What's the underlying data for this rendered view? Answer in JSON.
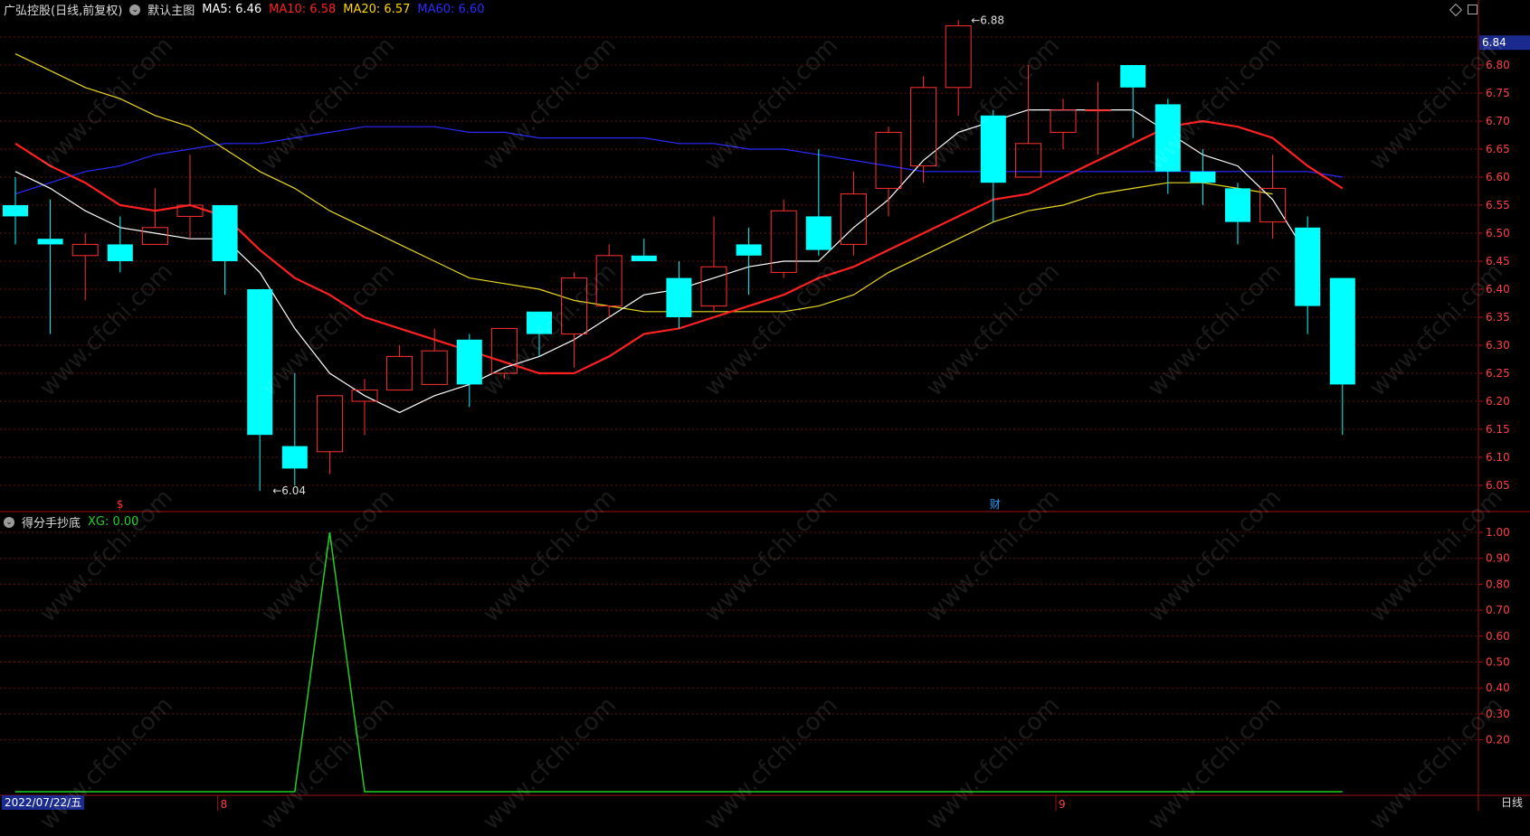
{
  "header": {
    "stock": "广弘控股(日线,前复权)",
    "main_label": "默认主图",
    "ma": [
      {
        "label": "MA5: 6.46",
        "color": "#ffffff"
      },
      {
        "label": "MA10: 6.58",
        "color": "#ff2020"
      },
      {
        "label": "MA20: 6.57",
        "color": "#ffd700"
      },
      {
        "label": "MA60: 6.60",
        "color": "#2a2aff"
      }
    ]
  },
  "indicator": {
    "name": "得分手抄底",
    "value_label": "XG: 0.00"
  },
  "footer": {
    "date": "2022/07/22/五",
    "period": "日线"
  },
  "watermark": "www.cfchi.com",
  "colors": {
    "up": "#ff3030",
    "down": "#00ffff",
    "grid": "#6a1010",
    "frame": "#a01010",
    "ma5": "#ffffff",
    "ma10": "#ff2020",
    "ma20": "#e8d820",
    "ma60": "#2a2aff",
    "xg": "#20d020"
  },
  "chart_data": [
    {
      "type": "candlestick",
      "ylim": [
        6.0,
        6.9
      ],
      "y_ticks": [
        "6.80",
        "6.75",
        "6.70",
        "6.65",
        "6.60",
        "6.55",
        "6.50",
        "6.45",
        "6.40",
        "6.35",
        "6.30",
        "6.25",
        "6.20",
        "6.15",
        "6.10",
        "6.05"
      ],
      "current_price": "6.84",
      "annotations": [
        {
          "text": "6.88",
          "index": 27,
          "value": 6.88
        },
        {
          "text": "6.04",
          "index": 7,
          "value": 6.04
        }
      ],
      "markers": [
        {
          "text": "$",
          "index": 3,
          "color": "#ff3030"
        },
        {
          "text": "财",
          "index": 28,
          "color": "#20a0ff"
        }
      ],
      "month_ticks": [
        {
          "text": "8",
          "index": 6
        },
        {
          "text": "9",
          "index": 30
        }
      ],
      "candles": [
        {
          "o": 6.55,
          "h": 6.6,
          "l": 6.48,
          "c": 6.53
        },
        {
          "o": 6.49,
          "h": 6.56,
          "l": 6.32,
          "c": 6.48
        },
        {
          "o": 6.46,
          "h": 6.5,
          "l": 6.38,
          "c": 6.48
        },
        {
          "o": 6.48,
          "h": 6.53,
          "l": 6.43,
          "c": 6.45
        },
        {
          "o": 6.48,
          "h": 6.58,
          "l": 6.48,
          "c": 6.51
        },
        {
          "o": 6.53,
          "h": 6.64,
          "l": 6.49,
          "c": 6.55
        },
        {
          "o": 6.55,
          "h": 6.55,
          "l": 6.39,
          "c": 6.45
        },
        {
          "o": 6.4,
          "h": 6.4,
          "l": 6.04,
          "c": 6.14
        },
        {
          "o": 6.12,
          "h": 6.25,
          "l": 6.05,
          "c": 6.08
        },
        {
          "o": 6.11,
          "h": 6.21,
          "l": 6.07,
          "c": 6.21
        },
        {
          "o": 6.2,
          "h": 6.24,
          "l": 6.14,
          "c": 6.22
        },
        {
          "o": 6.22,
          "h": 6.3,
          "l": 6.22,
          "c": 6.28
        },
        {
          "o": 6.23,
          "h": 6.33,
          "l": 6.23,
          "c": 6.29
        },
        {
          "o": 6.31,
          "h": 6.32,
          "l": 6.19,
          "c": 6.23
        },
        {
          "o": 6.25,
          "h": 6.33,
          "l": 6.24,
          "c": 6.33
        },
        {
          "o": 6.36,
          "h": 6.36,
          "l": 6.28,
          "c": 6.32
        },
        {
          "o": 6.32,
          "h": 6.43,
          "l": 6.26,
          "c": 6.42
        },
        {
          "o": 6.37,
          "h": 6.48,
          "l": 6.35,
          "c": 6.46
        },
        {
          "o": 6.46,
          "h": 6.49,
          "l": 6.45,
          "c": 6.45
        },
        {
          "o": 6.42,
          "h": 6.45,
          "l": 6.33,
          "c": 6.35
        },
        {
          "o": 6.37,
          "h": 6.53,
          "l": 6.36,
          "c": 6.44
        },
        {
          "o": 6.48,
          "h": 6.51,
          "l": 6.39,
          "c": 6.46
        },
        {
          "o": 6.43,
          "h": 6.56,
          "l": 6.42,
          "c": 6.54
        },
        {
          "o": 6.53,
          "h": 6.65,
          "l": 6.46,
          "c": 6.47
        },
        {
          "o": 6.48,
          "h": 6.61,
          "l": 6.46,
          "c": 6.57
        },
        {
          "o": 6.58,
          "h": 6.69,
          "l": 6.53,
          "c": 6.68
        },
        {
          "o": 6.62,
          "h": 6.78,
          "l": 6.59,
          "c": 6.76
        },
        {
          "o": 6.76,
          "h": 6.88,
          "l": 6.71,
          "c": 6.87
        },
        {
          "o": 6.71,
          "h": 6.72,
          "l": 6.52,
          "c": 6.59
        },
        {
          "o": 6.6,
          "h": 6.8,
          "l": 6.6,
          "c": 6.66
        },
        {
          "o": 6.68,
          "h": 6.74,
          "l": 6.65,
          "c": 6.72
        },
        {
          "o": 6.72,
          "h": 6.77,
          "l": 6.64,
          "c": 6.72
        },
        {
          "o": 6.8,
          "h": 6.8,
          "l": 6.67,
          "c": 6.76
        },
        {
          "o": 6.73,
          "h": 6.74,
          "l": 6.57,
          "c": 6.61
        },
        {
          "o": 6.61,
          "h": 6.65,
          "l": 6.55,
          "c": 6.59
        },
        {
          "o": 6.58,
          "h": 6.59,
          "l": 6.48,
          "c": 6.52
        },
        {
          "o": 6.52,
          "h": 6.64,
          "l": 6.49,
          "c": 6.58
        },
        {
          "o": 6.51,
          "h": 6.53,
          "l": 6.32,
          "c": 6.37
        },
        {
          "o": 6.42,
          "h": 6.42,
          "l": 6.14,
          "c": 6.23
        }
      ],
      "series": [
        {
          "name": "MA5",
          "values": [
            6.61,
            6.58,
            6.54,
            6.51,
            6.5,
            6.49,
            6.49,
            6.43,
            6.33,
            6.25,
            6.21,
            6.18,
            6.21,
            6.23,
            6.26,
            6.28,
            6.31,
            6.35,
            6.39,
            6.4,
            6.42,
            6.44,
            6.45,
            6.45,
            6.51,
            6.56,
            6.63,
            6.68,
            6.7,
            6.72,
            6.72,
            6.72,
            6.72,
            6.68,
            6.64,
            6.62,
            6.56,
            6.46
          ]
        },
        {
          "name": "MA10",
          "values": [
            6.66,
            6.62,
            6.59,
            6.55,
            6.54,
            6.55,
            6.53,
            6.47,
            6.42,
            6.39,
            6.35,
            6.33,
            6.31,
            6.29,
            6.27,
            6.25,
            6.25,
            6.28,
            6.32,
            6.33,
            6.35,
            6.37,
            6.39,
            6.42,
            6.44,
            6.47,
            6.5,
            6.53,
            6.56,
            6.57,
            6.6,
            6.63,
            6.66,
            6.69,
            6.7,
            6.69,
            6.67,
            6.62,
            6.58
          ]
        },
        {
          "name": "MA20",
          "values": [
            6.82,
            6.79,
            6.76,
            6.74,
            6.71,
            6.69,
            6.65,
            6.61,
            6.58,
            6.54,
            6.51,
            6.48,
            6.45,
            6.42,
            6.41,
            6.4,
            6.38,
            6.37,
            6.36,
            6.36,
            6.36,
            6.36,
            6.36,
            6.37,
            6.39,
            6.43,
            6.46,
            6.49,
            6.52,
            6.54,
            6.55,
            6.57,
            6.58,
            6.59,
            6.59,
            6.58,
            6.57
          ]
        },
        {
          "name": "MA60",
          "values": [
            6.57,
            6.59,
            6.61,
            6.62,
            6.64,
            6.65,
            6.66,
            6.66,
            6.67,
            6.68,
            6.69,
            6.69,
            6.69,
            6.68,
            6.68,
            6.67,
            6.67,
            6.67,
            6.67,
            6.66,
            6.66,
            6.65,
            6.65,
            6.64,
            6.63,
            6.62,
            6.61,
            6.61,
            6.61,
            6.61,
            6.61,
            6.61,
            6.61,
            6.61,
            6.61,
            6.61,
            6.61,
            6.61,
            6.6
          ]
        }
      ]
    },
    {
      "type": "line",
      "name": "XG",
      "ylim": [
        0,
        1.05
      ],
      "y_ticks": [
        "1.00",
        "0.90",
        "0.80",
        "0.70",
        "0.60",
        "0.50",
        "0.40",
        "0.30",
        "0.20"
      ],
      "values": [
        0,
        0,
        0,
        0,
        0,
        0,
        0,
        0,
        0,
        1,
        0,
        0,
        0,
        0,
        0,
        0,
        0,
        0,
        0,
        0,
        0,
        0,
        0,
        0,
        0,
        0,
        0,
        0,
        0,
        0,
        0,
        0,
        0,
        0,
        0,
        0,
        0,
        0,
        0
      ]
    }
  ]
}
